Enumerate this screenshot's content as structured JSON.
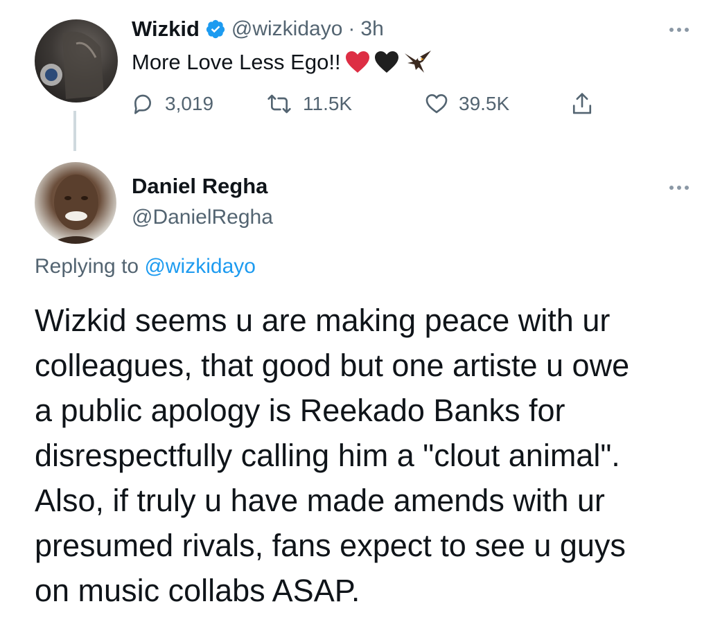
{
  "original_tweet": {
    "author_name": "Wizkid",
    "handle": "@wizkidayo",
    "separator": "·",
    "time": "3h",
    "text": "More Love Less Ego!!",
    "emojis": [
      "red-heart",
      "black-heart",
      "eagle"
    ],
    "stats": {
      "replies": "3,019",
      "retweets": "11.5K",
      "likes": "39.5K"
    }
  },
  "reply_tweet": {
    "author_name": "Daniel Regha",
    "handle": "@DanielRegha",
    "replying_prefix": "Replying to",
    "replying_to": "@wizkidayo",
    "body_lines": [
      "Wizkid seems u are making peace with ur",
      "colleagues, that good but one artiste u owe",
      "a public apology is Reekado Banks for",
      "disrespectfully calling him a \"clout animal\".",
      "Also, if truly u have made amends with ur",
      "presumed rivals, fans expect to see u guys",
      "on music collabs ASAP."
    ]
  },
  "colors": {
    "text_primary": "#0f1419",
    "text_secondary": "#536471",
    "accent_blue": "#1d9bf0",
    "thread_line": "#cfd9de"
  }
}
